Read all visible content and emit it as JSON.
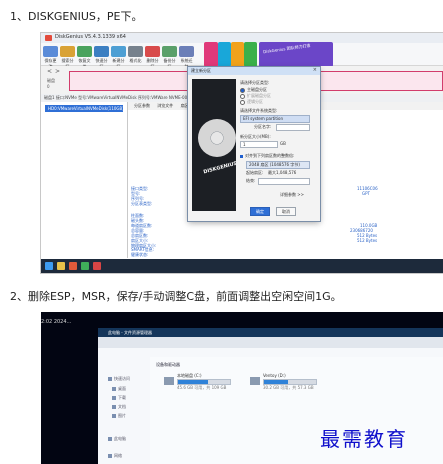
{
  "steps": [
    {
      "text": "1、DISKGENIUS，PE下。"
    },
    {
      "text": "2、删除ESP，MSR，保存/手动调整C盘，前面调整出空闲空间1G。"
    }
  ],
  "screenshot1": {
    "app_title": "DiskGenius V5.4.3.1339 x64",
    "toolbar": [
      "保存更改",
      "搜索分区",
      "恢复文件",
      "快速分区",
      "新建分区",
      "格式化",
      "删除分区",
      "备份分区",
      "系统迁移"
    ],
    "ad_text": "DiskGenius 团队倾力打造",
    "nav": [
      "<",
      ">"
    ],
    "side_labels": [
      "磁盘",
      "0"
    ],
    "disk_info": "磁盘1 接口:NVMe 型号:VMwareVirtualNVMeDisk 序列号:VMWare NVME-0000 容量:110.0GB(112640MB) 柱面数:14023",
    "tree_item": "HD0:VMwareVirtualNVMeDisk(110GB)",
    "tabs": [
      "分区参数",
      "浏览文件",
      "扇区编辑"
    ],
    "fields": [
      {
        "label": "接口类型:"
      },
      {
        "label": "型号:"
      },
      {
        "label": "序列号:"
      },
      {
        "label": "分区表类型:"
      }
    ],
    "fields2": [
      {
        "label": "柱面数:"
      },
      {
        "label": "磁头数:"
      },
      {
        "label": "每道扇区数:"
      },
      {
        "label": "总容量:"
      },
      {
        "label": "总扇区数:"
      },
      {
        "label": "扇区大小:"
      },
      {
        "label": "物理扇区大小:"
      }
    ],
    "fields3": [
      {
        "label": "SMART信息:"
      },
      {
        "label": "健康状态:"
      }
    ],
    "values": [
      "11106C06",
      "GPT"
    ],
    "values2": [
      "110.0GB",
      "230686720",
      "512 Bytes",
      "512 Bytes"
    ],
    "dialog": {
      "title": "建立新分区",
      "art_text": "DISKGENIUS",
      "section1": "请选择分区类型:",
      "option1": "主磁盘分区",
      "option2": "扩展磁盘分区",
      "option3": "逻辑分区",
      "section2": "请选择文件系统类型:",
      "fs_value": "EFI system partition",
      "partition_name_label": "分区名字:",
      "size_label": "新分区大小(MB):",
      "size_value": "1",
      "size_unit": "GB",
      "align_label": "对齐到下列扇区数的整数倍:",
      "align_value": "2048 扇区 (1048576 字节)",
      "sector_label": "起始扇区:",
      "sector_value": "最大1,048,576",
      "end_label": "结束:",
      "advanced_label": "详细参数 >>",
      "ok": "确定",
      "cancel": "取消"
    }
  },
  "screenshot2": {
    "time": "2:02 2024...",
    "window_title": "此电脑 - 文件资源管理器",
    "group_label": "设备和驱动器",
    "nav_items": [
      "快速访问",
      "桌面",
      "下载",
      "文档",
      "图片",
      "此电脑",
      "网络"
    ],
    "drives": [
      {
        "label": "本地磁盘 (C:)",
        "size": "45.6 GB 可用，共 109 GB",
        "fill": 0.58
      },
      {
        "label": "Ventoy (D:)",
        "size": "30.2 GB 可用，共 57.3 GB",
        "fill": 0.47
      }
    ]
  },
  "watermark": "最需教育",
  "colors": {
    "accent_blue": "#2f6fd6",
    "disk_bar_border": "#d23d6c",
    "explorer_titlebar": "#14355a",
    "watermark": "#1010cc"
  }
}
